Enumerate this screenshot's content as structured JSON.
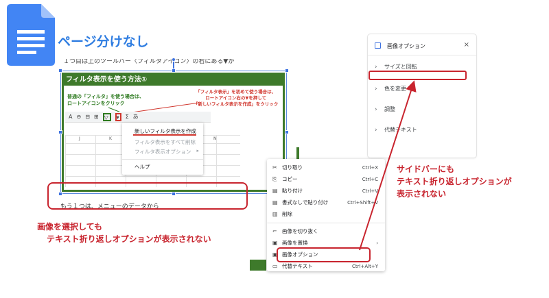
{
  "page": {
    "title": "ページ分けなし",
    "doc_cut_text": "１つ目は上のツールバー〈フィルタアイコン〉の右にある▼から作成する方法",
    "below_image_text": "もう１つは、メニューのデータから"
  },
  "screenshot_image": {
    "header": "フィルタ表示を使う方法①",
    "note_green": [
      "普通の「フィルタ」を使う場合は、",
      "ロートアイコンをクリック"
    ],
    "note_red": [
      "「フィルタ表示」を初めて使う場合は、",
      "ロートアイコン右の▼を押して",
      "「新しいフィルタ表示を作成」をクリック"
    ],
    "toolbar_items": [
      "A",
      "⊖",
      "⊟",
      "Σ",
      "あ"
    ],
    "columns": [
      "J",
      "K",
      "L",
      "M",
      "N"
    ],
    "filter_menu": {
      "items": [
        "新しいフィルタ表示を作成",
        "フィルタ表示をすべて削除",
        "フィルタ表示オプション",
        "ヘルプ"
      ]
    }
  },
  "captions": {
    "left": [
      "画像を選択しても",
      "テキスト折り返しオプションが表示されない"
    ],
    "right": [
      "サイドバーにも",
      "テキスト折り返しオプションが",
      "表示されない"
    ]
  },
  "sidebar": {
    "title": "画像オプション",
    "close": "×",
    "items": [
      "サイズと回転",
      "色を変更",
      "調整",
      "代替テキスト"
    ]
  },
  "context_menu": {
    "items": [
      {
        "icon": "✂",
        "label": "切り取り",
        "shortcut": "Ctrl+X"
      },
      {
        "icon": "⎘",
        "label": "コピー",
        "shortcut": "Ctrl+C"
      },
      {
        "icon": "📋",
        "label": "貼り付け",
        "shortcut": "Ctrl+V"
      },
      {
        "icon": "📋",
        "label": "書式なしで貼り付け",
        "shortcut": "Ctrl+Shift+V"
      },
      {
        "icon": "🗑",
        "label": "削除",
        "shortcut": ""
      },
      {
        "icon": "⌐",
        "label": "画像を切り抜く",
        "shortcut": ""
      },
      {
        "icon": "▣",
        "label": "画像を置換",
        "shortcut": "›"
      },
      {
        "icon": "▣",
        "label": "画像オプション",
        "shortcut": ""
      },
      {
        "icon": "▭",
        "label": "代替テキスト",
        "shortcut": "Ctrl+Alt+Y"
      }
    ]
  },
  "colors": {
    "accent_blue": "#2f7de1",
    "annotation_red": "#c8242e",
    "sheet_green": "#3e7a2b"
  }
}
